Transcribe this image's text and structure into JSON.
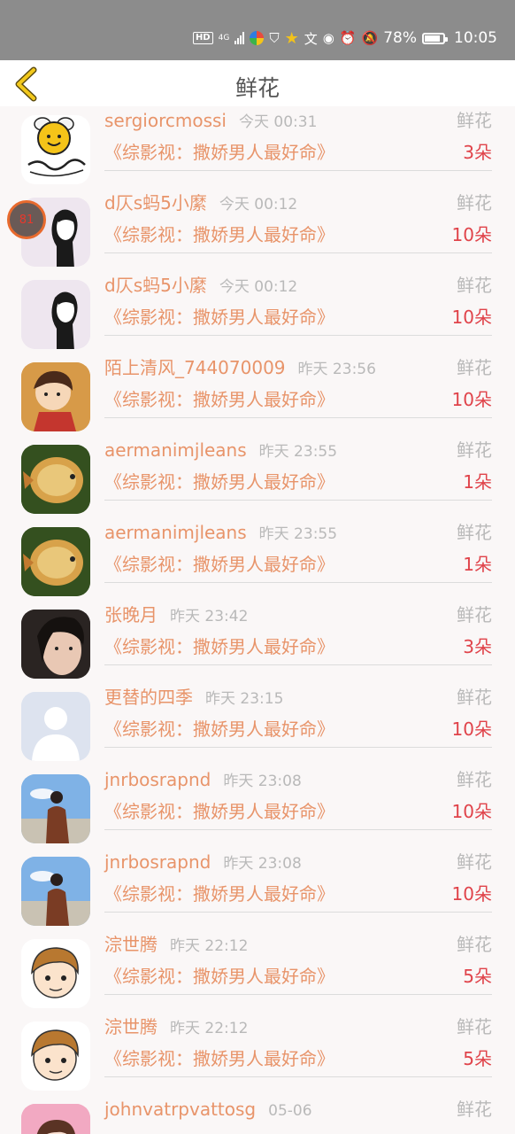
{
  "status_bar": {
    "hd": "HD",
    "network": "4G",
    "battery": "78%",
    "time": "10:05"
  },
  "header": {
    "title": "鲜花"
  },
  "float_widget": {
    "label": "81"
  },
  "items": [
    {
      "user": "sergiorcmossi",
      "time": "今天 00:31",
      "label": "鲜花",
      "work": "《综影视：撒娇男人最好命》",
      "count": "3朵",
      "avatar": "bee-logo"
    },
    {
      "user": "d仄s蚂5小縻",
      "time": "今天 00:12",
      "label": "鲜花",
      "work": "《综影视：撒娇男人最好命》",
      "count": "10朵",
      "avatar": "sketch-boy"
    },
    {
      "user": "d仄s蚂5小縻",
      "time": "今天 00:12",
      "label": "鲜花",
      "work": "《综影视：撒娇男人最好命》",
      "count": "10朵",
      "avatar": "sketch-boy"
    },
    {
      "user": "陌上清风_744070009",
      "time": "昨天 23:56",
      "label": "鲜花",
      "work": "《综影视：撒娇男人最好命》",
      "count": "10朵",
      "avatar": "cartoon-girl"
    },
    {
      "user": "aermanimjleans",
      "time": "昨天 23:55",
      "label": "鲜花",
      "work": "《综影视：撒娇男人最好命》",
      "count": "1朵",
      "avatar": "fish"
    },
    {
      "user": "aermanimjleans",
      "time": "昨天 23:55",
      "label": "鲜花",
      "work": "《综影视：撒娇男人最好命》",
      "count": "1朵",
      "avatar": "fish"
    },
    {
      "user": "张晚月",
      "time": "昨天 23:42",
      "label": "鲜花",
      "work": "《综影视：撒娇男人最好命》",
      "count": "3朵",
      "avatar": "portrait"
    },
    {
      "user": "更替的四季",
      "time": "昨天 23:15",
      "label": "鲜花",
      "work": "《综影视：撒娇男人最好命》",
      "count": "10朵",
      "avatar": "default-user"
    },
    {
      "user": "jnrbosrapnd",
      "time": "昨天 23:08",
      "label": "鲜花",
      "work": "《综影视：撒娇男人最好命》",
      "count": "10朵",
      "avatar": "beach"
    },
    {
      "user": "jnrbosrapnd",
      "time": "昨天 23:08",
      "label": "鲜花",
      "work": "《综影视：撒娇男人最好命》",
      "count": "10朵",
      "avatar": "beach"
    },
    {
      "user": "淙世腾",
      "time": "昨天 22:12",
      "label": "鲜花",
      "work": "《综影视：撒娇男人最好命》",
      "count": "5朵",
      "avatar": "anime-boy"
    },
    {
      "user": "淙世腾",
      "time": "昨天 22:12",
      "label": "鲜花",
      "work": "《综影视：撒娇男人最好命》",
      "count": "5朵",
      "avatar": "anime-boy"
    },
    {
      "user": "johnvatrpvattosg",
      "time": "05-06",
      "label": "鲜花",
      "work": "",
      "count": "",
      "avatar": "pink-girl"
    }
  ]
}
